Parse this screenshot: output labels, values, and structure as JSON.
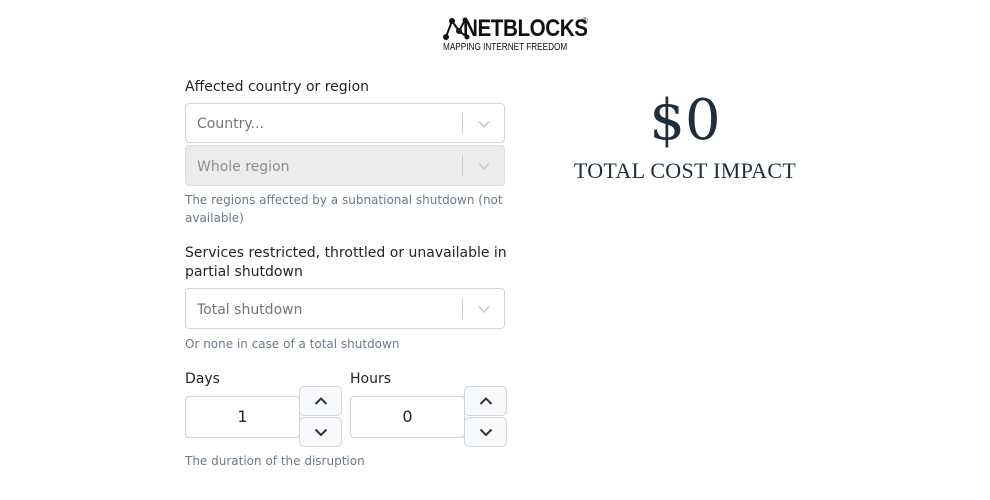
{
  "logo": {
    "name": "NETBLOCKS",
    "registered": "®",
    "tagline": "MAPPING INTERNET FREEDOM"
  },
  "country_field": {
    "label": "Affected country or region",
    "country_placeholder": "Country...",
    "region_placeholder": "Whole region",
    "help": "The regions affected by a subnational shutdown (not available)"
  },
  "services_field": {
    "label": "Services restricted, throttled or unavailable in partial shutdown",
    "placeholder": "Total shutdown",
    "help": "Or none in case of a total shutdown"
  },
  "duration": {
    "days_label": "Days",
    "days_value": "1",
    "hours_label": "Hours",
    "hours_value": "0",
    "help": "The duration of the disruption"
  },
  "result": {
    "amount": "$0",
    "label": "TOTAL COST IMPACT"
  },
  "icons": [
    "netblocks-logo-icon",
    "chevron-down-icon",
    "chevron-up-icon"
  ]
}
